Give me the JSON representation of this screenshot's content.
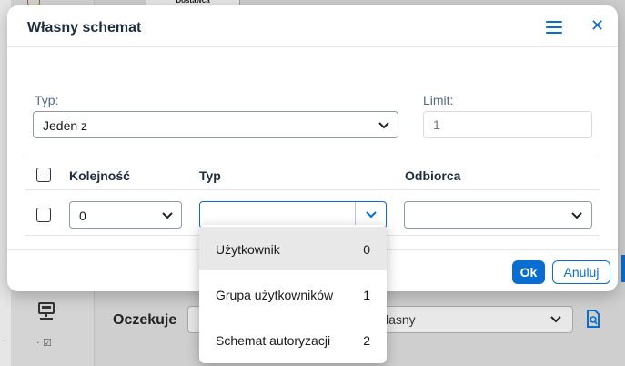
{
  "background": {
    "top_tab_label": "Dostawca",
    "filter_label": "Oczekuje",
    "filter_value": "łasny"
  },
  "dialog": {
    "title": "Własny schemat",
    "type_label": "Typ:",
    "type_value": "Jeden z",
    "limit_label": "Limit:",
    "limit_placeholder": "1",
    "table": {
      "headers": [
        "Kolejność",
        "Typ",
        "Odbiorca"
      ],
      "row": {
        "order": "0",
        "type": "",
        "recipient": ""
      }
    },
    "ok_label": "Ok",
    "cancel_label": "Anuluj"
  },
  "dropdown": {
    "options": [
      {
        "label": "Użytkownik",
        "key": "0",
        "selected": true
      },
      {
        "label": "Grupa użytkowników",
        "key": "1",
        "selected": false
      },
      {
        "label": "Schemat autoryzacji",
        "key": "2",
        "selected": false
      }
    ]
  },
  "colors": {
    "accent": "#0a6ed1",
    "text": "#1d2d3e",
    "label": "#556b82"
  }
}
